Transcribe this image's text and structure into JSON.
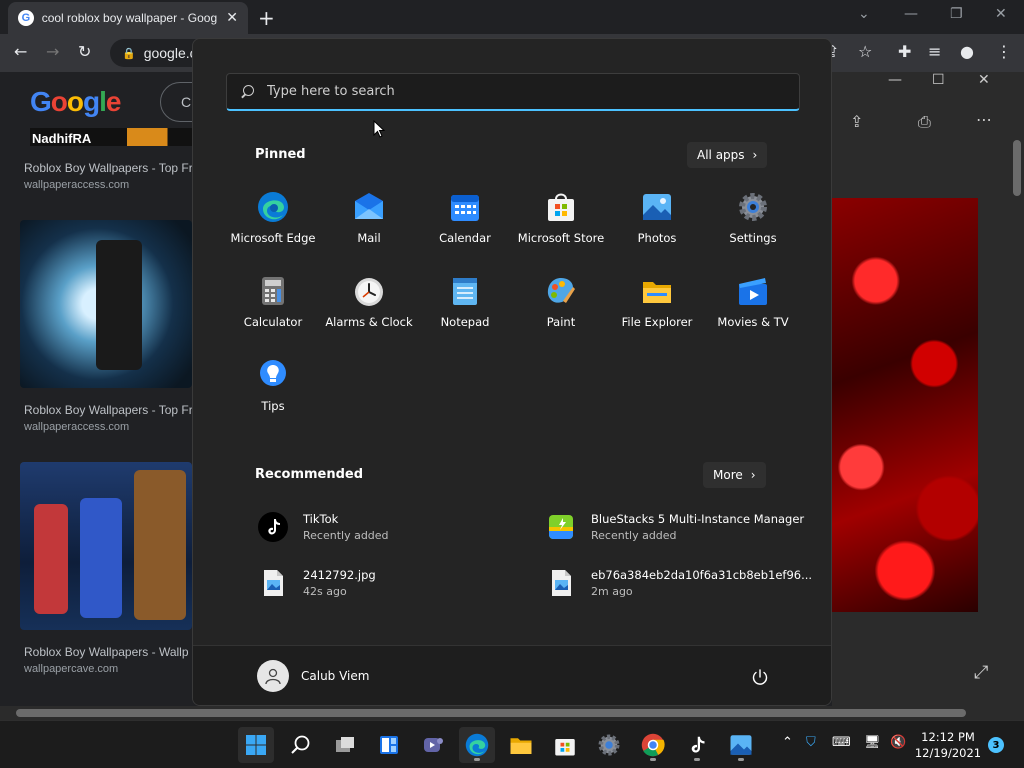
{
  "browser": {
    "tab_title": "cool roblox boy wallpaper - Goog",
    "omnibox": "google.c",
    "google_logo": "Google",
    "search_partial": "C",
    "results": [
      {
        "title": "Roblox Boy Wallpapers - Top Fr",
        "source": "wallpaperaccess.com"
      },
      {
        "title": "Roblox Boy Wallpapers - Top Fr",
        "source": "wallpaperaccess.com"
      },
      {
        "title": "Roblox Boy Wallpapers - Wallp",
        "source": "wallpapercave.com"
      }
    ],
    "banner_text": "NadhifRA"
  },
  "start_menu": {
    "search_placeholder": "Type here to search",
    "pinned_title": "Pinned",
    "all_apps_label": "All apps",
    "pinned_apps": [
      {
        "label": "Microsoft Edge",
        "icon": "edge-icon"
      },
      {
        "label": "Mail",
        "icon": "mail-icon"
      },
      {
        "label": "Calendar",
        "icon": "calendar-icon"
      },
      {
        "label": "Microsoft Store",
        "icon": "store-icon"
      },
      {
        "label": "Photos",
        "icon": "photos-icon"
      },
      {
        "label": "Settings",
        "icon": "gear-icon"
      },
      {
        "label": "Calculator",
        "icon": "calculator-icon"
      },
      {
        "label": "Alarms & Clock",
        "icon": "clock-icon"
      },
      {
        "label": "Notepad",
        "icon": "notepad-icon"
      },
      {
        "label": "Paint",
        "icon": "paint-icon"
      },
      {
        "label": "File Explorer",
        "icon": "folder-icon"
      },
      {
        "label": "Movies & TV",
        "icon": "movies-icon"
      },
      {
        "label": "Tips",
        "icon": "lightbulb-icon"
      }
    ],
    "recommended_title": "Recommended",
    "more_label": "More",
    "recommended": [
      {
        "name": "TikTok",
        "sub": "Recently added",
        "icon": "tiktok-icon"
      },
      {
        "name": "BlueStacks 5 Multi-Instance Manager",
        "sub": "Recently added",
        "icon": "bluestacks-icon"
      },
      {
        "name": "2412792.jpg",
        "sub": "42s ago",
        "icon": "image-file-icon"
      },
      {
        "name": "eb76a384eb2da10f6a31cb8eb1ef96...",
        "sub": "2m ago",
        "icon": "image-file-icon"
      }
    ],
    "user_name": "Calub Viem"
  },
  "taskbar": {
    "time": "12:12 PM",
    "date": "12/19/2021",
    "notification_count": "3"
  },
  "colors": {
    "accent": "#4cc2ff",
    "start_bg": "#242424",
    "taskbar_bg": "#1c1c1c"
  }
}
